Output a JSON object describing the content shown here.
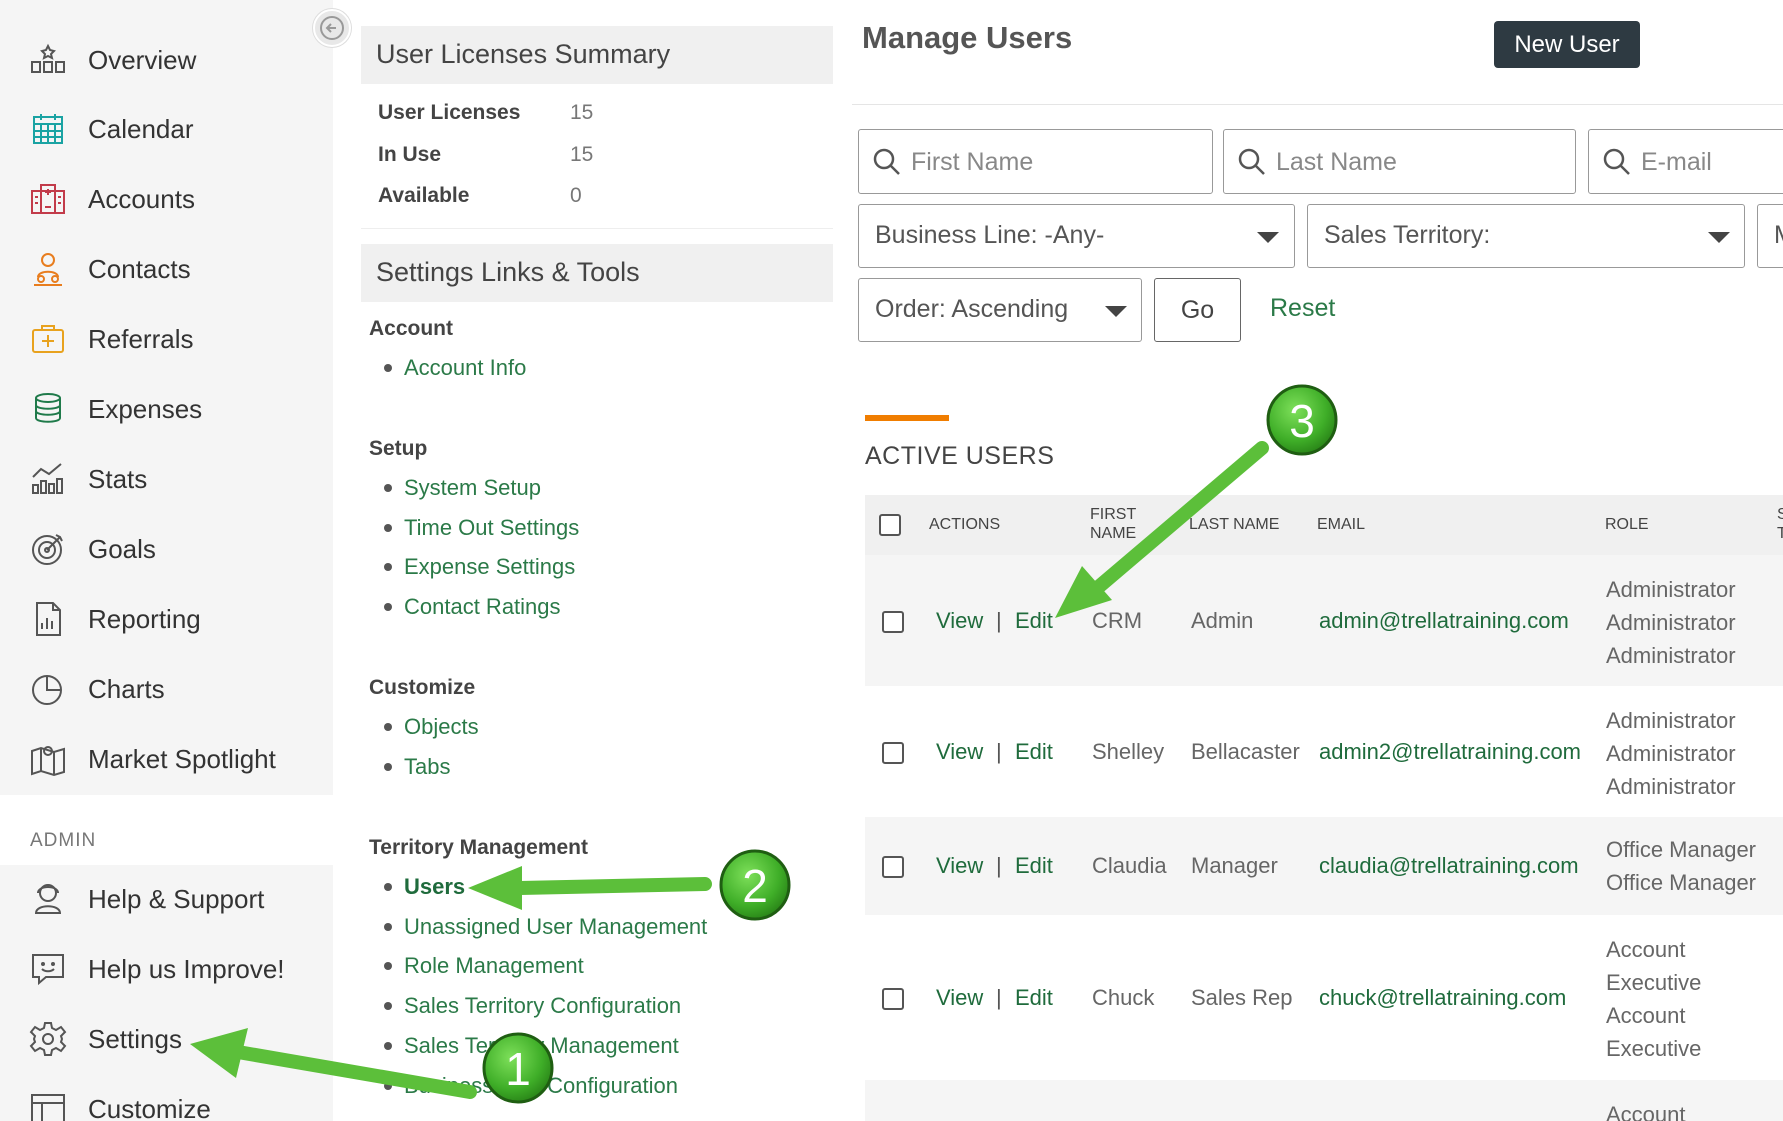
{
  "sidebar": {
    "items": [
      {
        "label": "Overview",
        "icon": "overview-icon"
      },
      {
        "label": "Calendar",
        "icon": "calendar-icon"
      },
      {
        "label": "Accounts",
        "icon": "accounts-icon"
      },
      {
        "label": "Contacts",
        "icon": "contacts-icon"
      },
      {
        "label": "Referrals",
        "icon": "referrals-icon"
      },
      {
        "label": "Expenses",
        "icon": "expenses-icon"
      },
      {
        "label": "Stats",
        "icon": "stats-icon"
      },
      {
        "label": "Goals",
        "icon": "goals-icon"
      },
      {
        "label": "Reporting",
        "icon": "reporting-icon"
      },
      {
        "label": "Charts",
        "icon": "charts-icon"
      },
      {
        "label": "Market Spotlight",
        "icon": "market-spotlight-icon"
      }
    ],
    "admin_label": "ADMIN",
    "admin_items": [
      {
        "label": "Help & Support",
        "icon": "help-support-icon"
      },
      {
        "label": "Help us Improve!",
        "icon": "feedback-icon"
      },
      {
        "label": "Settings",
        "icon": "gear-icon"
      },
      {
        "label": "Customize",
        "icon": "customize-icon"
      }
    ]
  },
  "licenses": {
    "title": "User Licenses Summary",
    "rows": [
      {
        "label": "User Licenses",
        "value": "15"
      },
      {
        "label": "In Use",
        "value": "15"
      },
      {
        "label": "Available",
        "value": "0"
      }
    ]
  },
  "settings_tools": {
    "title": "Settings Links & Tools",
    "sections": [
      {
        "title": "Account",
        "links": [
          "Account Info"
        ]
      },
      {
        "title": "Setup",
        "links": [
          "System Setup",
          "Time Out Settings",
          "Expense Settings",
          "Contact Ratings"
        ]
      },
      {
        "title": "Customize",
        "links": [
          "Objects",
          "Tabs"
        ]
      },
      {
        "title": "Territory Management",
        "links": [
          "Users",
          "Unassigned User Management",
          "Role Management",
          "Sales Territory Configuration",
          "Sales Territory Management",
          "Business Line Configuration"
        ]
      }
    ]
  },
  "main": {
    "title": "Manage Users",
    "new_user_label": "New User",
    "search": {
      "first_name_placeholder": "First Name",
      "last_name_placeholder": "Last Name",
      "email_placeholder": "E-mail"
    },
    "filters": {
      "business_line": "Business Line:  -Any-",
      "sales_territory": "Sales Territory:",
      "third_partial": "M",
      "order": "Order:  Ascending"
    },
    "go_label": "Go",
    "reset_label": "Reset",
    "active_title": "ACTIVE USERS",
    "accent_color": "#f07d00",
    "link_color": "#2b7a48",
    "columns": {
      "actions": "ACTIONS",
      "first_name_l1": "FIRST",
      "first_name_l2": "NAME",
      "last_name": "LAST NAME",
      "email": "EMAIL",
      "role": "ROLE",
      "partial_l1": "S",
      "partial_l2": "T"
    },
    "view_label": "View",
    "edit_label": "Edit",
    "separator": "|",
    "rows": [
      {
        "first": "CRM",
        "last": "Admin",
        "email": "admin@trellatraining.com",
        "roles": [
          "Administrator",
          "Administrator",
          "Administrator"
        ]
      },
      {
        "first": "Shelley",
        "last": "Bellacaster",
        "email": "admin2@trellatraining.com",
        "roles": [
          "Administrator",
          "Administrator",
          "Administrator"
        ]
      },
      {
        "first": "Claudia",
        "last": "Manager",
        "email": "claudia@trellatraining.com",
        "roles": [
          "Office Manager",
          "Office Manager"
        ]
      },
      {
        "first": "Chuck",
        "last": "Sales Rep",
        "email": "chuck@trellatraining.com",
        "roles": [
          "Account",
          "Executive",
          "Account",
          "Executive"
        ]
      },
      {
        "first": "",
        "last": "",
        "email": "",
        "roles": [
          "Account"
        ]
      }
    ]
  },
  "annotations": {
    "markers": [
      "1",
      "2",
      "3"
    ],
    "arrow_color": "#5cbf3a"
  }
}
